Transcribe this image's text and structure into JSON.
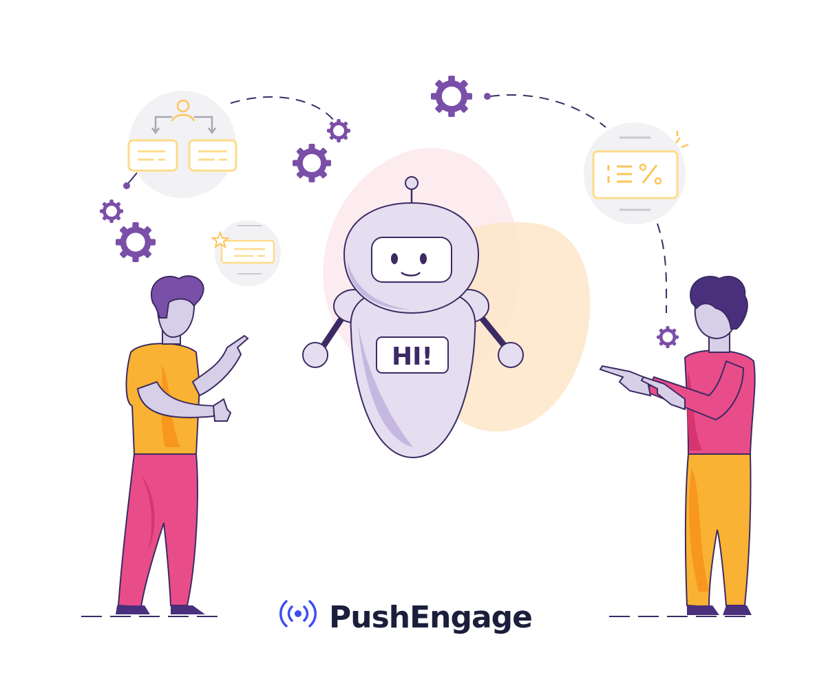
{
  "robot": {
    "chest_label": "HI!"
  },
  "brand": {
    "name": "PushEngage"
  },
  "colors": {
    "brand_blue": "#3d4ef0",
    "brand_text": "#1b1f3b",
    "purple": "#7a4fa8",
    "outline": "#3b2a63",
    "robot_body": "#e4def0",
    "robot_shade": "#c5b8e0",
    "orange": "#f9b233",
    "pink": "#e84d8a",
    "skin": "#d6cfe7",
    "card_yellow": "#fddc8a",
    "bubble_grey": "#f2f2f5"
  }
}
